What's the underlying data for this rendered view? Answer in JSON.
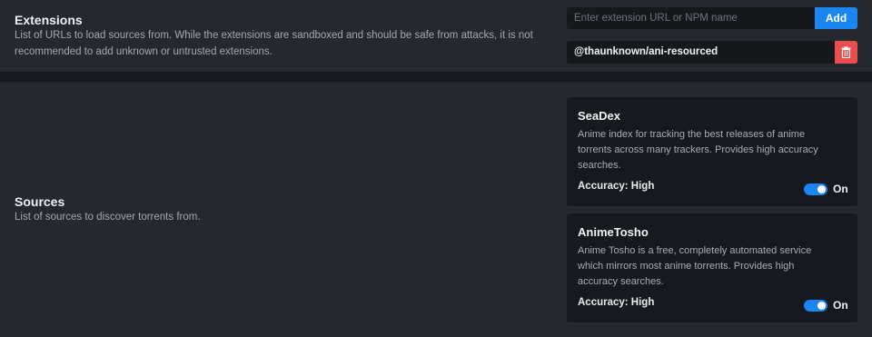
{
  "extensions": {
    "title": "Extensions",
    "description": "List of URLs to load sources from. While the extensions are sandboxed and should be safe from attacks, it is not recommended to add unknown or untrusted extensions.",
    "input_placeholder": "Enter extension URL or NPM name",
    "add_label": "Add",
    "items": [
      {
        "name": "@thaunknown/ani-resourced",
        "delete_icon": "trash-icon"
      }
    ],
    "colors": {
      "accent": "#1b86f0",
      "danger": "#ea4d4d"
    }
  },
  "sources": {
    "title": "Sources",
    "description": "List of sources to discover torrents from.",
    "items": [
      {
        "name": "SeaDex",
        "description": "Anime index for tracking the best releases of anime torrents across many trackers. Provides high accuracy searches.",
        "accuracy": "Accuracy: High",
        "enabled": true,
        "toggle_label": "On"
      },
      {
        "name": "AnimeTosho",
        "description": "Anime Tosho is a free, completely automated service which mirrors most anime torrents. Provides high accuracy searches.",
        "accuracy": "Accuracy: High",
        "enabled": true,
        "toggle_label": "On"
      }
    ]
  }
}
